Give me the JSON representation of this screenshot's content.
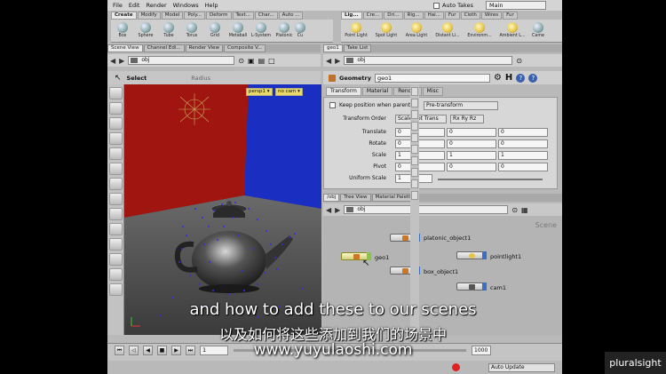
{
  "menubar": {
    "items": [
      "File",
      "Edit",
      "Render",
      "Windows",
      "Help"
    ],
    "auto_takes": "Auto Takes",
    "desktop": "Main"
  },
  "shelf_left": {
    "tabs": [
      "Create",
      "Modify",
      "Model",
      "Poly...",
      "Deform",
      "Text...",
      "Char...",
      "Auto ..."
    ],
    "tools": [
      "Box",
      "Sphere",
      "Tube",
      "Torus",
      "Grid",
      "Metaball",
      "L-System",
      "Platonic",
      "Cu"
    ]
  },
  "shelf_right": {
    "tabs": [
      "Lig...",
      "Cre...",
      "Dri...",
      "Rig...",
      "Hai...",
      "Fur",
      "Cloth",
      "Wires",
      "Fur"
    ],
    "tools": [
      "Point Light",
      "Spot Light",
      "Area Light",
      "Distant Li...",
      "Environm...",
      "Ambient L...",
      "Came"
    ]
  },
  "left_pane": {
    "tabs": [
      "Scene View",
      "Channel Edi...",
      "Render View",
      "Composite V..."
    ],
    "path": "obj"
  },
  "right_pane": {
    "tabs": [
      "geo1",
      "Take List"
    ],
    "path": "obj"
  },
  "viewport": {
    "tool": "Select",
    "radius_label": "Radius",
    "camera": "persp1 ▾",
    "cam_select": "no cam ▾"
  },
  "parameters": {
    "node_type": "Geometry",
    "node_name": "geo1",
    "tabs": [
      "Transform",
      "Material",
      "Render",
      "Misc"
    ],
    "keep_position": "Keep position when parenting",
    "keep_mode": "Pre-transform",
    "transform_order_label": "Transform Order",
    "transform_order": "Scale Rot Trans",
    "rot_order": "Rx Ry Rz",
    "rows": [
      {
        "label": "Translate",
        "x": "0",
        "y": "0",
        "z": "0"
      },
      {
        "label": "Rotate",
        "x": "0",
        "y": "0",
        "z": "0"
      },
      {
        "label": "Scale",
        "x": "1",
        "y": "1",
        "z": "1"
      },
      {
        "label": "Pivot",
        "x": "0",
        "y": "0",
        "z": "0"
      }
    ],
    "uniform_scale_label": "Uniform Scale",
    "uniform_scale": "1"
  },
  "network": {
    "tabs": [
      "/obj",
      "Tree View",
      "Material Palette"
    ],
    "path": "obj",
    "context": "Scene",
    "nodes": [
      "platonic_object1",
      "geo1",
      "box_object1",
      "pointlight1",
      "cam1"
    ]
  },
  "playbar": {
    "frame": "1",
    "end": "1000",
    "update_mode": "Auto Update"
  },
  "subtitles": {
    "en": "and how to add these to our scenes",
    "zh": "以及如何将这些添加到我们的场景中"
  },
  "watermark": "www.yuyulaoshi.com",
  "brand": "pluralsight"
}
